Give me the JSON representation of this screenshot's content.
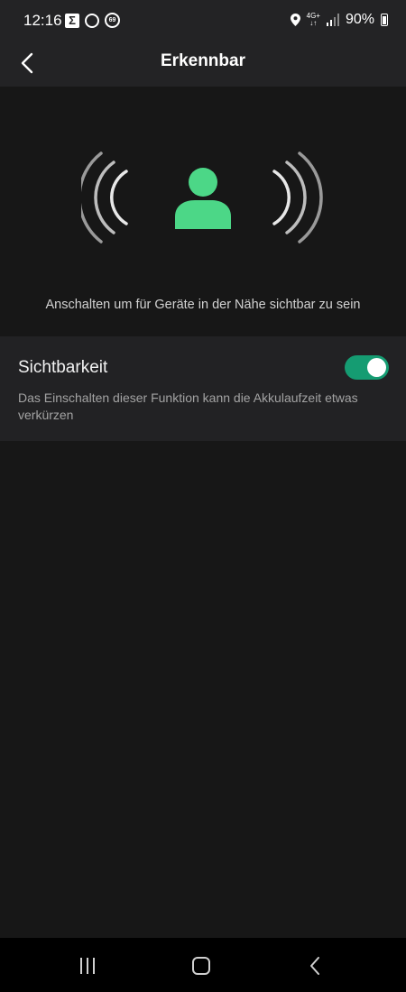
{
  "status_bar": {
    "time": "12:16",
    "badge_number": "69",
    "network": "4G+",
    "battery": "90%"
  },
  "app_bar": {
    "title": "Erkennbar",
    "back_icon": "chevron-left-icon"
  },
  "hero": {
    "icon": "person-broadcast-icon",
    "caption": "Anschalten um für Geräte in der Nähe sichtbar zu sein",
    "accent": "#4cd787"
  },
  "setting": {
    "title": "Sichtbarkeit",
    "description": "Das Einschalten dieser Funktion kann die Akkulaufzeit etwas verkürzen",
    "toggle_on": true,
    "toggle_color": "#159c72"
  },
  "nav_bar": {
    "recents_icon": "recents-icon",
    "home_icon": "home-icon",
    "back_icon": "back-icon"
  }
}
